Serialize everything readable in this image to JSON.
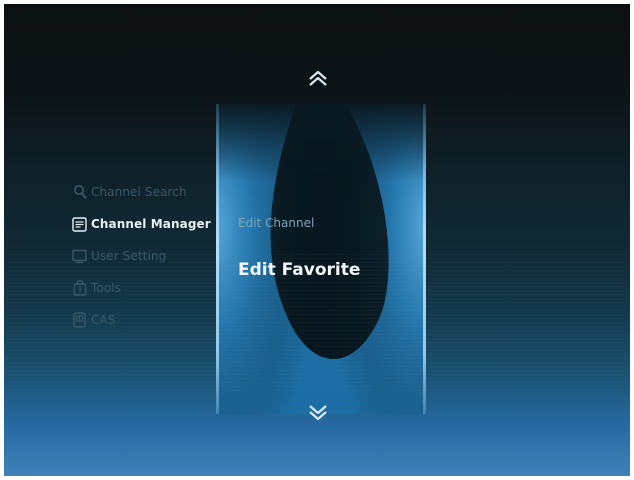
{
  "menu": {
    "items": [
      {
        "label": "Channel Search",
        "icon": "magnifier-icon",
        "active": false
      },
      {
        "label": "Channel Manager",
        "icon": "list-icon",
        "active": true
      },
      {
        "label": "User Setting",
        "icon": "monitor-icon",
        "active": false
      },
      {
        "label": "Tools",
        "icon": "toolbox-icon",
        "active": false
      },
      {
        "label": "CAS",
        "icon": "card-icon",
        "active": false
      }
    ]
  },
  "submenu": {
    "options": [
      {
        "label": "Edit Channel",
        "selected": false
      },
      {
        "label": "Edit Favorite",
        "selected": true
      }
    ]
  },
  "colors": {
    "active_text": "#e8f1f5",
    "inactive_text": "#3a5866",
    "accent_blue": "#2669a0"
  }
}
